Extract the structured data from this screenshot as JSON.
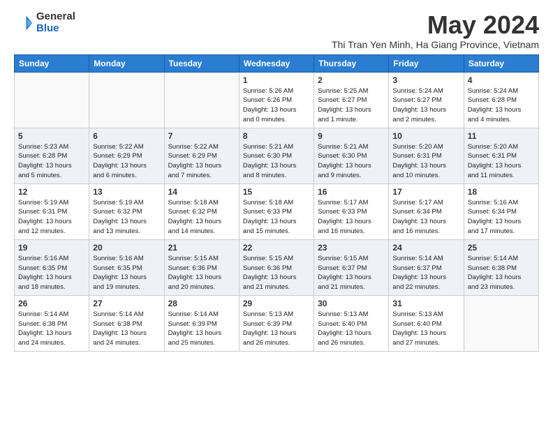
{
  "logo": {
    "general": "General",
    "blue": "Blue"
  },
  "title": "May 2024",
  "subtitle": "Thi Tran Yen Minh, Ha Giang Province, Vietnam",
  "days": [
    "Sunday",
    "Monday",
    "Tuesday",
    "Wednesday",
    "Thursday",
    "Friday",
    "Saturday"
  ],
  "weeks": [
    [
      {
        "day": "",
        "info": ""
      },
      {
        "day": "",
        "info": ""
      },
      {
        "day": "",
        "info": ""
      },
      {
        "day": "1",
        "info": "Sunrise: 5:26 AM\nSunset: 6:26 PM\nDaylight: 13 hours\nand 0 minutes."
      },
      {
        "day": "2",
        "info": "Sunrise: 5:25 AM\nSunset: 6:27 PM\nDaylight: 13 hours\nand 1 minute."
      },
      {
        "day": "3",
        "info": "Sunrise: 5:24 AM\nSunset: 6:27 PM\nDaylight: 13 hours\nand 2 minutes."
      },
      {
        "day": "4",
        "info": "Sunrise: 5:24 AM\nSunset: 6:28 PM\nDaylight: 13 hours\nand 4 minutes."
      }
    ],
    [
      {
        "day": "5",
        "info": "Sunrise: 5:23 AM\nSunset: 6:28 PM\nDaylight: 13 hours\nand 5 minutes."
      },
      {
        "day": "6",
        "info": "Sunrise: 5:22 AM\nSunset: 6:29 PM\nDaylight: 13 hours\nand 6 minutes."
      },
      {
        "day": "7",
        "info": "Sunrise: 5:22 AM\nSunset: 6:29 PM\nDaylight: 13 hours\nand 7 minutes."
      },
      {
        "day": "8",
        "info": "Sunrise: 5:21 AM\nSunset: 6:30 PM\nDaylight: 13 hours\nand 8 minutes."
      },
      {
        "day": "9",
        "info": "Sunrise: 5:21 AM\nSunset: 6:30 PM\nDaylight: 13 hours\nand 9 minutes."
      },
      {
        "day": "10",
        "info": "Sunrise: 5:20 AM\nSunset: 6:31 PM\nDaylight: 13 hours\nand 10 minutes."
      },
      {
        "day": "11",
        "info": "Sunrise: 5:20 AM\nSunset: 6:31 PM\nDaylight: 13 hours\nand 11 minutes."
      }
    ],
    [
      {
        "day": "12",
        "info": "Sunrise: 5:19 AM\nSunset: 6:31 PM\nDaylight: 13 hours\nand 12 minutes."
      },
      {
        "day": "13",
        "info": "Sunrise: 5:19 AM\nSunset: 6:32 PM\nDaylight: 13 hours\nand 13 minutes."
      },
      {
        "day": "14",
        "info": "Sunrise: 5:18 AM\nSunset: 6:32 PM\nDaylight: 13 hours\nand 14 minutes."
      },
      {
        "day": "15",
        "info": "Sunrise: 5:18 AM\nSunset: 6:33 PM\nDaylight: 13 hours\nand 15 minutes."
      },
      {
        "day": "16",
        "info": "Sunrise: 5:17 AM\nSunset: 6:33 PM\nDaylight: 13 hours\nand 16 minutes."
      },
      {
        "day": "17",
        "info": "Sunrise: 5:17 AM\nSunset: 6:34 PM\nDaylight: 13 hours\nand 16 minutes."
      },
      {
        "day": "18",
        "info": "Sunrise: 5:16 AM\nSunset: 6:34 PM\nDaylight: 13 hours\nand 17 minutes."
      }
    ],
    [
      {
        "day": "19",
        "info": "Sunrise: 5:16 AM\nSunset: 6:35 PM\nDaylight: 13 hours\nand 18 minutes."
      },
      {
        "day": "20",
        "info": "Sunrise: 5:16 AM\nSunset: 6:35 PM\nDaylight: 13 hours\nand 19 minutes."
      },
      {
        "day": "21",
        "info": "Sunrise: 5:15 AM\nSunset: 6:36 PM\nDaylight: 13 hours\nand 20 minutes."
      },
      {
        "day": "22",
        "info": "Sunrise: 5:15 AM\nSunset: 6:36 PM\nDaylight: 13 hours\nand 21 minutes."
      },
      {
        "day": "23",
        "info": "Sunrise: 5:15 AM\nSunset: 6:37 PM\nDaylight: 13 hours\nand 21 minutes."
      },
      {
        "day": "24",
        "info": "Sunrise: 5:14 AM\nSunset: 6:37 PM\nDaylight: 13 hours\nand 22 minutes."
      },
      {
        "day": "25",
        "info": "Sunrise: 5:14 AM\nSunset: 6:38 PM\nDaylight: 13 hours\nand 23 minutes."
      }
    ],
    [
      {
        "day": "26",
        "info": "Sunrise: 5:14 AM\nSunset: 6:38 PM\nDaylight: 13 hours\nand 24 minutes."
      },
      {
        "day": "27",
        "info": "Sunrise: 5:14 AM\nSunset: 6:38 PM\nDaylight: 13 hours\nand 24 minutes."
      },
      {
        "day": "28",
        "info": "Sunrise: 5:14 AM\nSunset: 6:39 PM\nDaylight: 13 hours\nand 25 minutes."
      },
      {
        "day": "29",
        "info": "Sunrise: 5:13 AM\nSunset: 6:39 PM\nDaylight: 13 hours\nand 26 minutes."
      },
      {
        "day": "30",
        "info": "Sunrise: 5:13 AM\nSunset: 6:40 PM\nDaylight: 13 hours\nand 26 minutes."
      },
      {
        "day": "31",
        "info": "Sunrise: 5:13 AM\nSunset: 6:40 PM\nDaylight: 13 hours\nand 27 minutes."
      },
      {
        "day": "",
        "info": ""
      }
    ]
  ]
}
